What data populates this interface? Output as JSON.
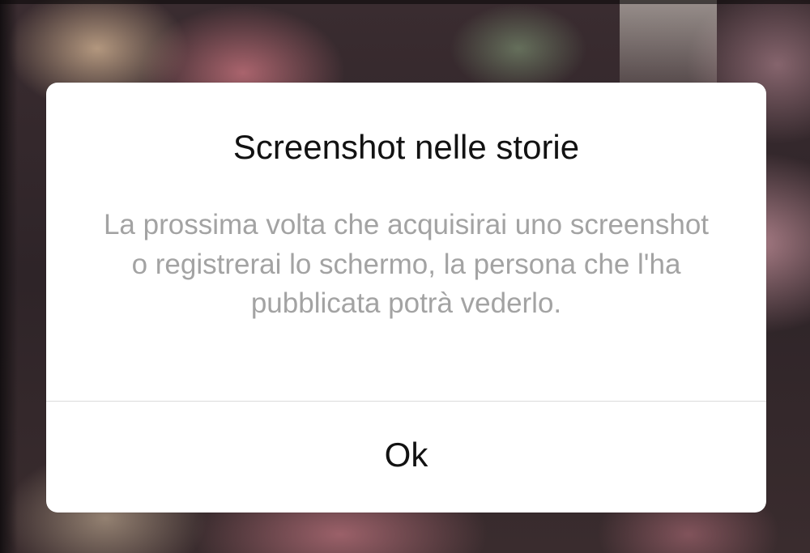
{
  "dialog": {
    "title": "Screenshot nelle storie",
    "message": "La prossima volta che acquisirai uno screenshot o registrerai lo schermo, la persona che l'ha pubblicata potrà vederlo.",
    "ok_label": "Ok"
  },
  "colors": {
    "dialog_background": "#ffffff",
    "title_text": "#121212",
    "message_text": "#a3a3a3",
    "divider": "#dcdcdc"
  }
}
